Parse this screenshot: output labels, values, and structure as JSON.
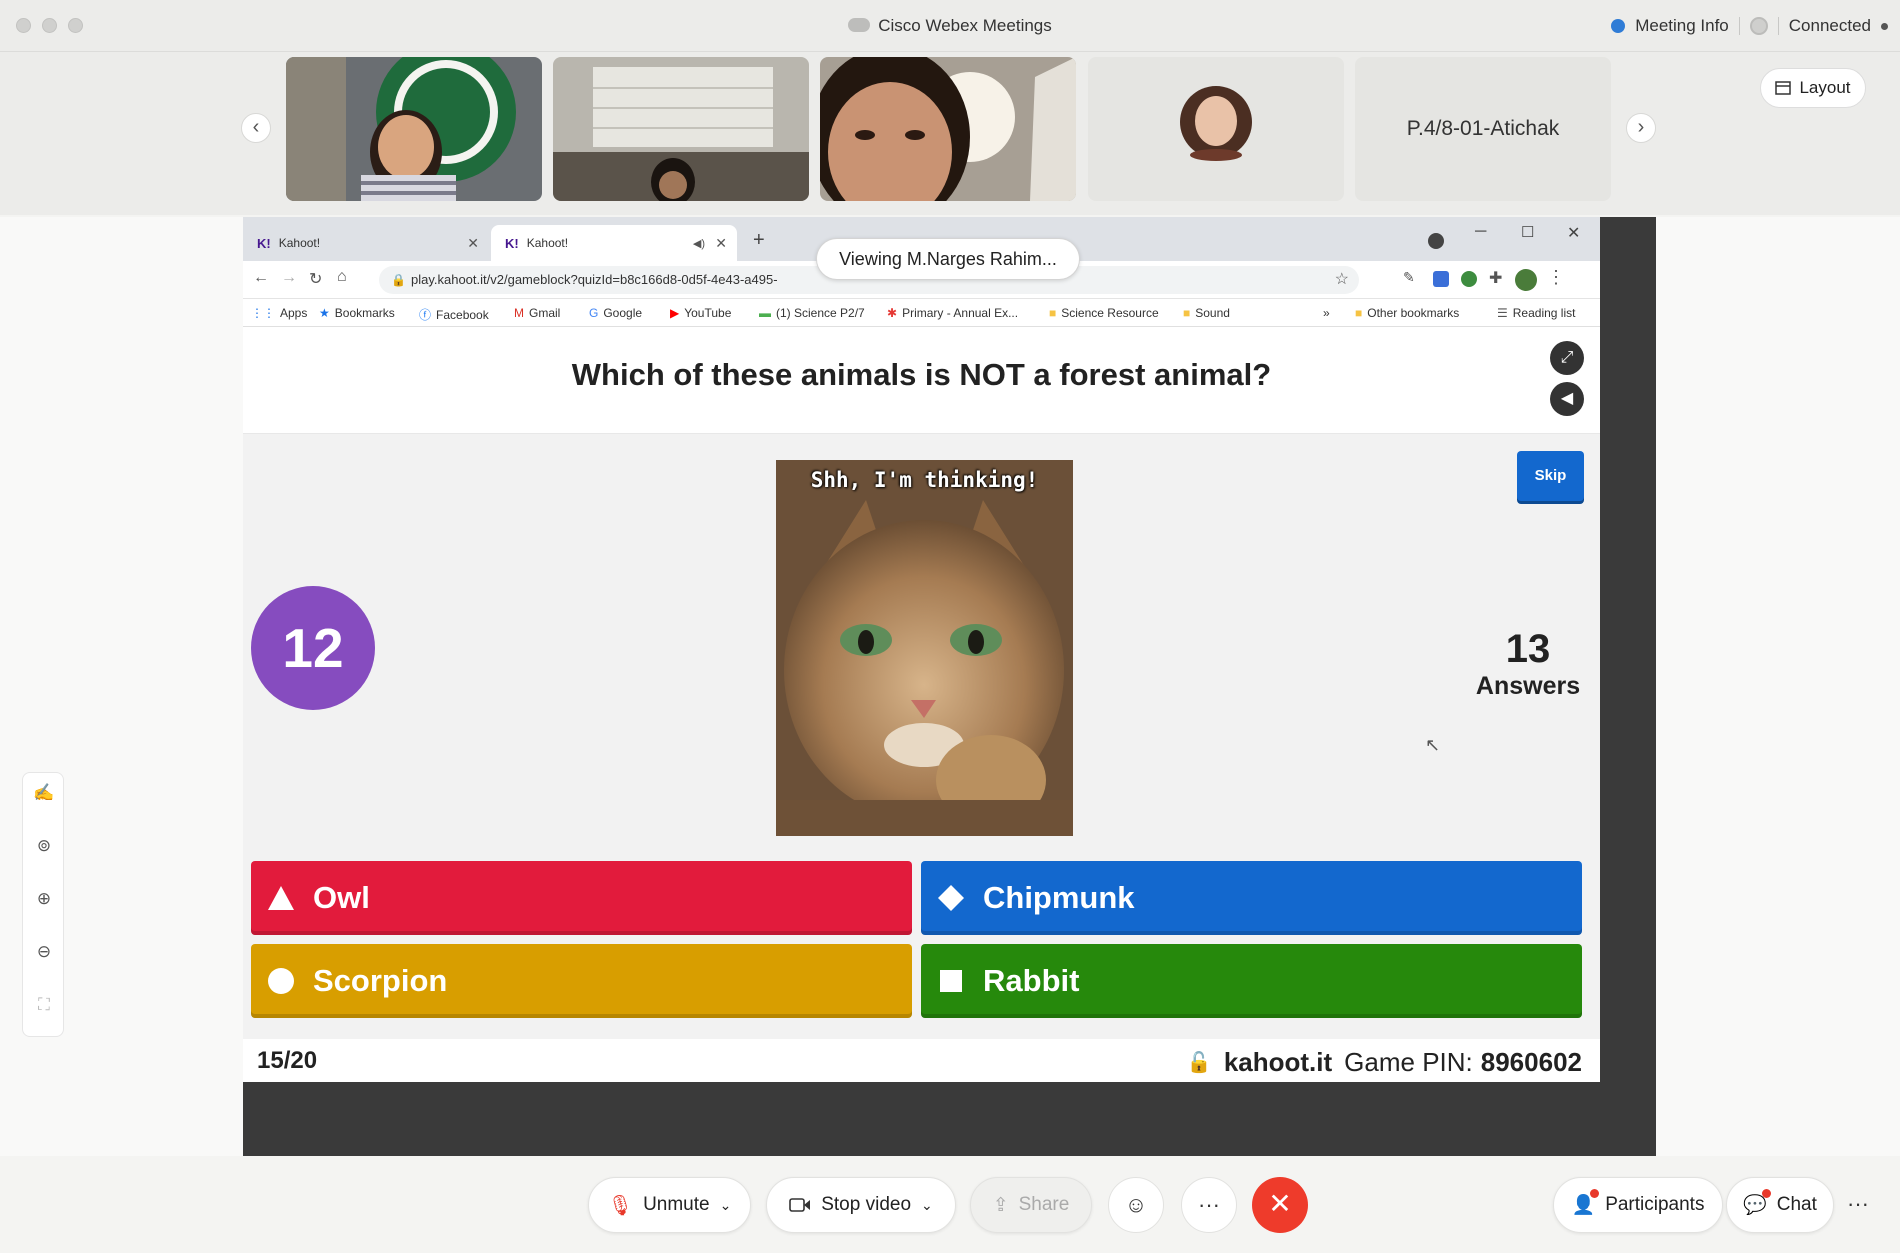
{
  "window": {
    "title": "Cisco Webex Meetings",
    "meeting_info": "Meeting Info",
    "status": "Connected"
  },
  "filmstrip": {
    "participant_name": "P.4/8-01-Atichak",
    "layout_label": "Layout",
    "prev_icon": "chevron-left-icon",
    "next_icon": "chevron-right-icon"
  },
  "share": {
    "viewing_label": "Viewing M.Narges Rahim..."
  },
  "browser": {
    "tabs": [
      {
        "label": "Kahoot!"
      },
      {
        "label": "Kahoot!"
      }
    ],
    "url": "play.kahoot.it/v2/gameblock?quizId=b8c166d8-0d5f-4e43-a495-",
    "bookmarks": [
      {
        "label": "Apps"
      },
      {
        "label": "Bookmarks"
      },
      {
        "label": "Facebook"
      },
      {
        "label": "Gmail"
      },
      {
        "label": "Google"
      },
      {
        "label": "YouTube"
      },
      {
        "label": "(1) Science P2/7"
      },
      {
        "label": "Primary - Annual Ex..."
      },
      {
        "label": "Science Resource"
      },
      {
        "label": "Sound"
      },
      {
        "label": "Other bookmarks"
      },
      {
        "label": "Reading list"
      }
    ],
    "more_bookmarks": "»"
  },
  "kahoot": {
    "question": "Which of these animals is NOT a forest animal?",
    "skip_label": "Skip",
    "timer": "12",
    "answers_count": "13",
    "answers_label": "Answers",
    "image_caption": "Shh, I'm thinking!",
    "options": [
      {
        "label": "Owl",
        "color": "#e21b3c",
        "shape": "triangle-icon"
      },
      {
        "label": "Chipmunk",
        "color": "#1368ce",
        "shape": "diamond-icon"
      },
      {
        "label": "Scorpion",
        "color": "#d89e00",
        "shape": "circle-icon"
      },
      {
        "label": "Rabbit",
        "color": "#26890c",
        "shape": "square-icon"
      }
    ],
    "progress": "15/20",
    "site": "kahoot.it",
    "pin_label": "Game PIN:",
    "pin": "8960602"
  },
  "controls": {
    "unmute": "Unmute",
    "stop_video": "Stop video",
    "share": "Share",
    "participants": "Participants",
    "chat": "Chat",
    "more": "···"
  }
}
